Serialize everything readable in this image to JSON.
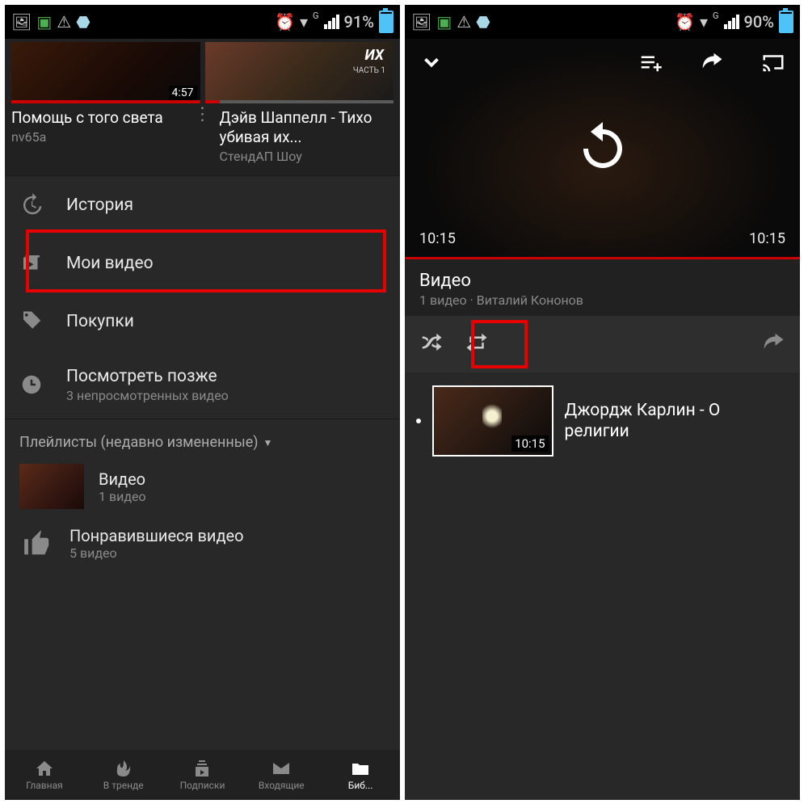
{
  "left": {
    "statusbar": {
      "battery_pct": "91%"
    },
    "videos": [
      {
        "title": "Помощь с того света",
        "channel": "nv65a",
        "duration": "4:57"
      },
      {
        "title": "Дэйв Шаппелл - Тихо убивая их...",
        "channel": "СтендАП Шоу",
        "thumb_text": "ИХ",
        "thumb_text2": "ЧАСТЬ 1"
      }
    ],
    "menu": {
      "history": "История",
      "myvideos": "Мои видео",
      "purchases": "Покупки",
      "watchlater": "Посмотреть позже",
      "watchlater_sub": "3 непросмотренных видео"
    },
    "playlists_header": "Плейлисты (недавно измененные)",
    "playlists": [
      {
        "title": "Видео",
        "sub": "1 видео"
      },
      {
        "title": "Понравившиеся видео",
        "sub": "5 видео"
      }
    ],
    "nav": {
      "home": "Главная",
      "trending": "В тренде",
      "subs": "Подписки",
      "inbox": "Входящие",
      "library": "Биб..."
    }
  },
  "right": {
    "statusbar": {
      "battery_pct": "90%"
    },
    "player": {
      "time_left": "10:15",
      "time_right": "10:15"
    },
    "playlist": {
      "title": "Видео",
      "sub": "1 видео · Виталий Кононов"
    },
    "track": {
      "title": "Джордж Карлин - О религии",
      "duration": "10:15"
    }
  }
}
